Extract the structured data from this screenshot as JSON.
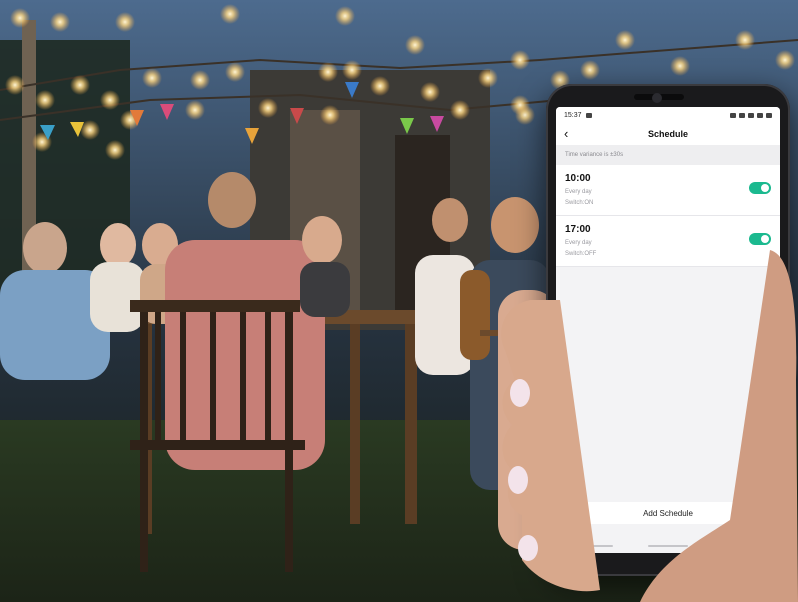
{
  "colors": {
    "accent": "#1bb98f",
    "screen_bg": "#f3f3f5"
  },
  "status": {
    "time": "15:37"
  },
  "header": {
    "back_icon": "chevron-left-icon",
    "back_glyph": "‹",
    "title": "Schedule"
  },
  "variance_note": "Time variance is ±30s",
  "schedules": [
    {
      "time": "10:00",
      "repeat": "Every day",
      "action": "Switch:ON",
      "enabled": true
    },
    {
      "time": "17:00",
      "repeat": "Every day",
      "action": "Switch:OFF",
      "enabled": true
    }
  ],
  "add_button_label": "Add Schedule"
}
